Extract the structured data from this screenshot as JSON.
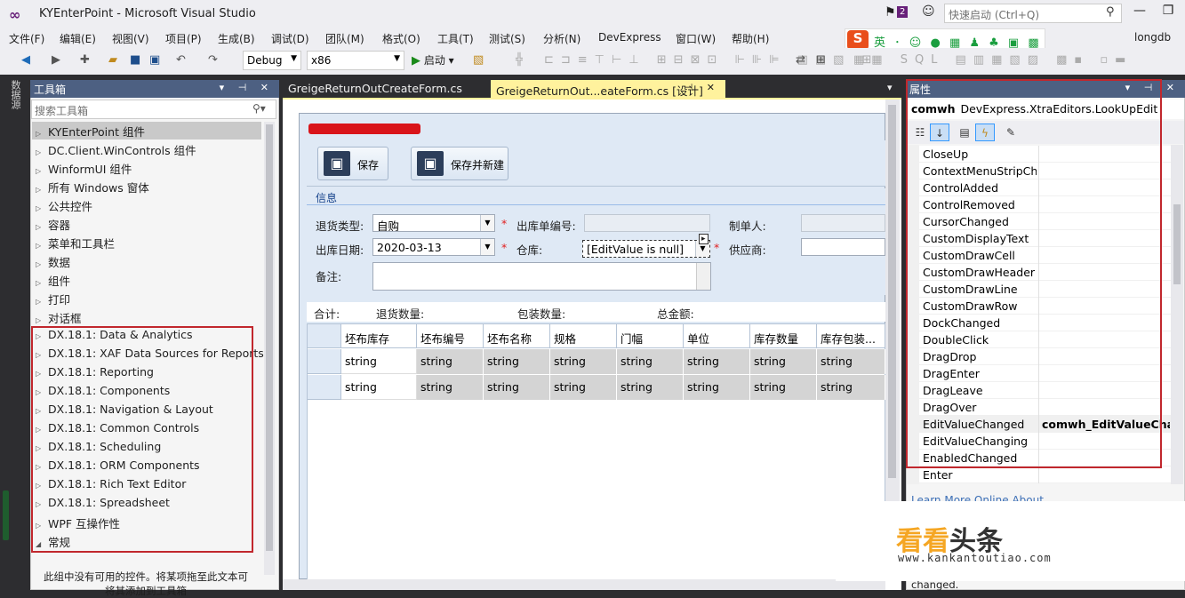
{
  "window": {
    "title": "KYEnterPoint - Microsoft Visual Studio",
    "notification_count": "2",
    "quick_launch_placeholder": "快速启动 (Ctrl+Q)",
    "user": "longdb"
  },
  "menu": [
    "文件(F)",
    "编辑(E)",
    "视图(V)",
    "项目(P)",
    "生成(B)",
    "调试(D)",
    "团队(M)",
    "格式(O)",
    "工具(T)",
    "测试(S)",
    "分析(N)",
    "DevExpress",
    "窗口(W)",
    "帮助(H)"
  ],
  "ime": {
    "logo": "S",
    "mode": "英"
  },
  "toolbar": {
    "config": "Debug",
    "platform": "x86",
    "run_label": "启动"
  },
  "side_tab": "数据源",
  "toolbox": {
    "title": "工具箱",
    "search_placeholder": "搜索工具箱",
    "groups": [
      "KYEnterPoint 组件",
      "DC.Client.WinControls 组件",
      "WinformUI 组件",
      "所有 Windows 窗体",
      "公共控件",
      "容器",
      "菜单和工具栏",
      "数据",
      "组件",
      "打印",
      "对话框",
      "DX.18.1: Data & Analytics",
      "DX.18.1: XAF Data Sources for Reports",
      "DX.18.1: Reporting",
      "DX.18.1: Components",
      "DX.18.1: Navigation & Layout",
      "DX.18.1: Common Controls",
      "DX.18.1: Scheduling",
      "DX.18.1: ORM Components",
      "DX.18.1: Rich Text Editor",
      "DX.18.1: Spreadsheet",
      "WPF 互操作性",
      "常规"
    ],
    "empty_message": "此组中没有可用的控件。将某项拖至此文本可将其添加到工具箱"
  },
  "tabs": [
    {
      "label": "GreigeReturnOutCreateForm.cs"
    },
    {
      "label": "GreigeReturnOut...eateForm.cs [设计]"
    }
  ],
  "form": {
    "buttons": {
      "save": "保存",
      "save_new": "保存并新建"
    },
    "info_title": "信息",
    "labels": {
      "return_type": "退货类型:",
      "out_no": "出库单编号:",
      "maker": "制单人:",
      "out_date": "出库日期:",
      "warehouse": "仓库:",
      "supplier": "供应商:",
      "remark": "备注:"
    },
    "values": {
      "return_type": "自购",
      "out_date": "2020-03-13",
      "warehouse": "[EditValue is null]"
    },
    "summary": {
      "total": "合计:",
      "return_qty": "退货数量:",
      "pack_qty": "包装数量:",
      "total_amount": "总金额:"
    },
    "grid": {
      "columns": [
        "坯布库存",
        "坯布编号",
        "坯布名称",
        "规格",
        "门幅",
        "单位",
        "库存数量",
        "库存包装..."
      ],
      "rows": [
        [
          "string",
          "string",
          "string",
          "string",
          "string",
          "string",
          "string",
          "string"
        ],
        [
          "string",
          "string",
          "string",
          "string",
          "string",
          "string",
          "string",
          "string"
        ]
      ]
    }
  },
  "properties": {
    "title": "属性",
    "object_name": "comwh",
    "object_type": "DevExpress.XtraEditors.LookUpEdit",
    "events": [
      {
        "name": "CloseUp",
        "value": ""
      },
      {
        "name": "ContextMenuStripChar",
        "value": ""
      },
      {
        "name": "ControlAdded",
        "value": ""
      },
      {
        "name": "ControlRemoved",
        "value": ""
      },
      {
        "name": "CursorChanged",
        "value": ""
      },
      {
        "name": "CustomDisplayText",
        "value": ""
      },
      {
        "name": "CustomDrawCell",
        "value": ""
      },
      {
        "name": "CustomDrawHeader",
        "value": ""
      },
      {
        "name": "CustomDrawLine",
        "value": ""
      },
      {
        "name": "CustomDrawRow",
        "value": ""
      },
      {
        "name": "DockChanged",
        "value": ""
      },
      {
        "name": "DoubleClick",
        "value": ""
      },
      {
        "name": "DragDrop",
        "value": ""
      },
      {
        "name": "DragEnter",
        "value": ""
      },
      {
        "name": "DragLeave",
        "value": ""
      },
      {
        "name": "DragOver",
        "value": ""
      },
      {
        "name": "EditValueChanged",
        "value": "comwh_EditValueChanged"
      },
      {
        "name": "EditValueChanging",
        "value": ""
      },
      {
        "name": "EnabledChanged",
        "value": ""
      },
      {
        "name": "Enter",
        "value": ""
      }
    ],
    "learn_more": "Learn More Online  About",
    "description_tail": "changed."
  },
  "watermark": {
    "text_a": "看看",
    "text_b": "头条",
    "url": "www.kankantoutiao.com"
  }
}
